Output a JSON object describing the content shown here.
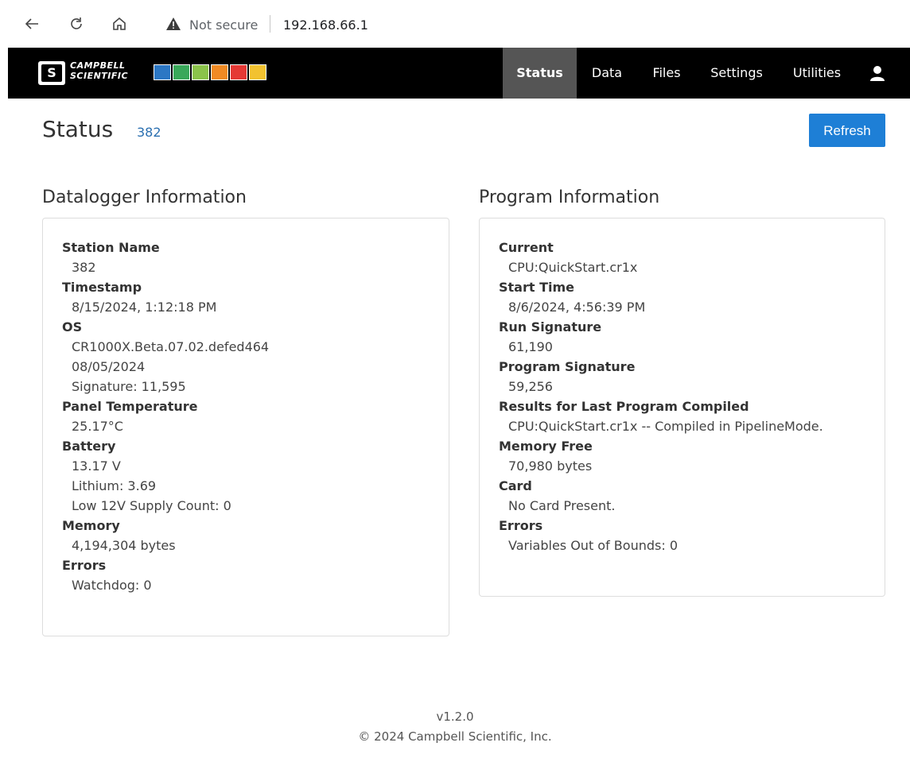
{
  "browser": {
    "warning": "Not secure",
    "address": "192.168.66.1"
  },
  "brand": {
    "logo_letter": "S",
    "name_line1": "CAMPBELL",
    "name_line2": "SCIENTIFIC",
    "tile_colors": [
      "#2c77c4",
      "#39a85a",
      "#8bc34a",
      "#f08a24",
      "#e53935",
      "#f2c230"
    ]
  },
  "nav": {
    "items": [
      "Status",
      "Data",
      "Files",
      "Settings",
      "Utilities"
    ],
    "active": "Status"
  },
  "page": {
    "title": "Status",
    "station": "382",
    "refresh_label": "Refresh"
  },
  "datalogger": {
    "title": "Datalogger Information",
    "station_name_label": "Station Name",
    "station_name": "382",
    "timestamp_label": "Timestamp",
    "timestamp": "8/15/2024, 1:12:18 PM",
    "os_label": "OS",
    "os_version": "CR1000X.Beta.07.02.defed464",
    "os_date": "08/05/2024",
    "os_signature": "Signature: 11,595",
    "panel_temp_label": "Panel Temperature",
    "panel_temp": "25.17°C",
    "battery_label": "Battery",
    "battery_voltage": "13.17 V",
    "lithium": "Lithium: 3.69",
    "low_supply": "Low 12V Supply Count: 0",
    "memory_label": "Memory",
    "memory": "4,194,304 bytes",
    "errors_label": "Errors",
    "watchdog": "Watchdog: 0"
  },
  "program": {
    "title": "Program Information",
    "current_label": "Current",
    "current": "CPU:QuickStart.cr1x",
    "start_time_label": "Start Time",
    "start_time": "8/6/2024, 4:56:39 PM",
    "run_sig_label": "Run Signature",
    "run_sig": "61,190",
    "prog_sig_label": "Program Signature",
    "prog_sig": "59,256",
    "results_label": "Results for Last Program Compiled",
    "results": "CPU:QuickStart.cr1x -- Compiled in PipelineMode.",
    "mem_free_label": "Memory Free",
    "mem_free": "70,980 bytes",
    "card_label": "Card",
    "card": "No Card Present.",
    "errors_label": "Errors",
    "vars_oob": "Variables Out of Bounds:  0"
  },
  "footer": {
    "version": "v1.2.0",
    "copyright": "© 2024 Campbell Scientific, Inc."
  },
  "colors": {
    "accent": "#1e7fd6",
    "navbar": "#000000",
    "nav_active": "#555555",
    "link": "#2a6fb0"
  }
}
